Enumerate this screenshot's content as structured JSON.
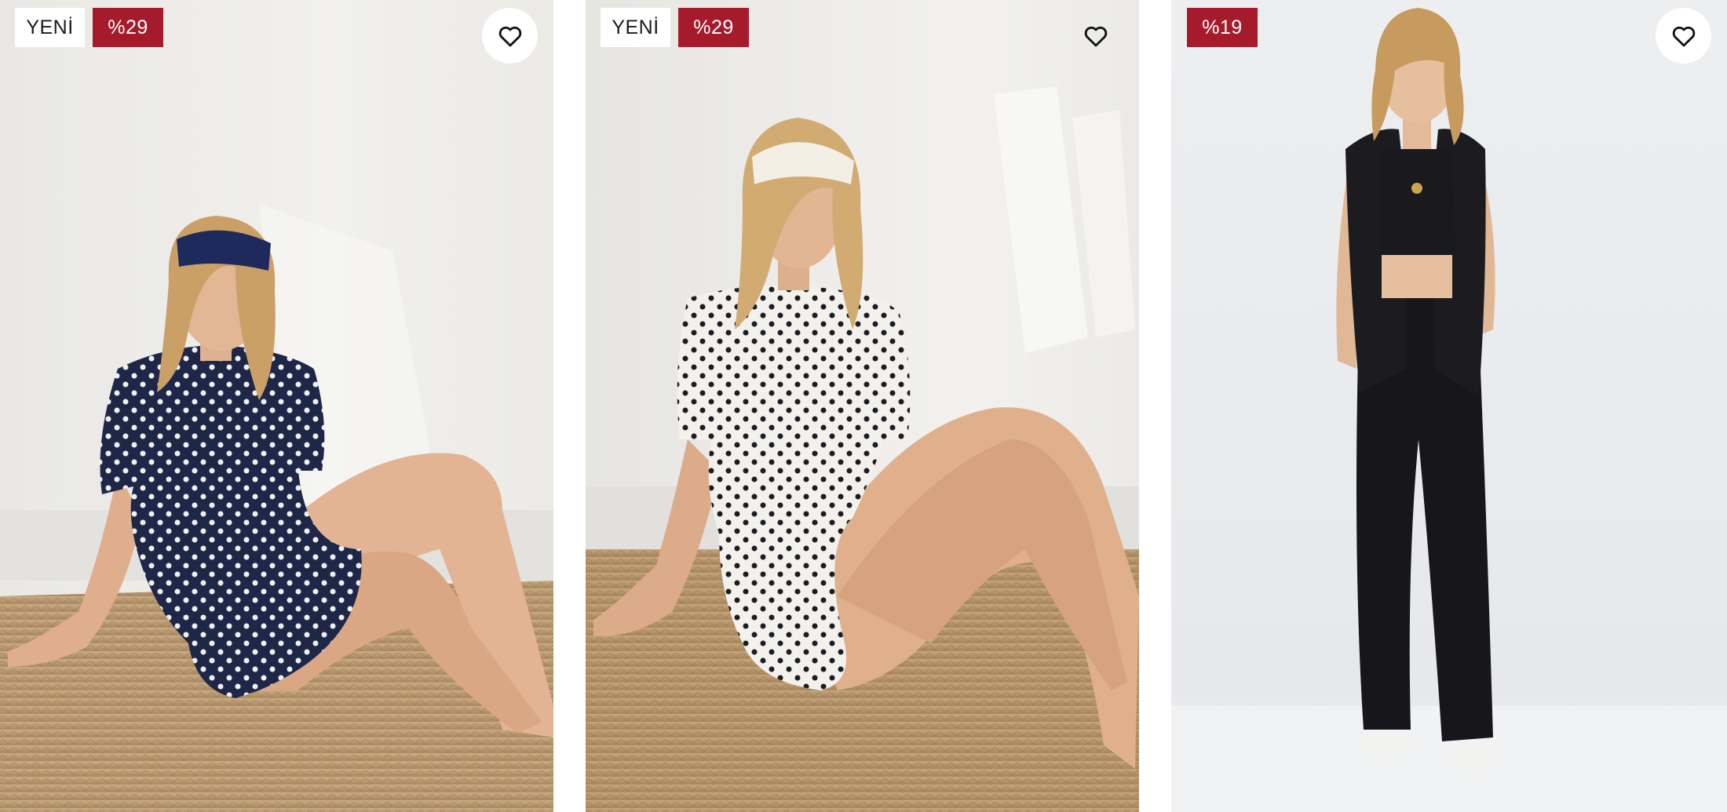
{
  "products": [
    {
      "badges": {
        "new": "YENİ",
        "discount": "%29"
      },
      "favorite_icon": "heart-outline-icon",
      "image_alt": "navy polka dot pajama set"
    },
    {
      "badges": {
        "new": "YENİ",
        "discount": "%29"
      },
      "favorite_icon": "heart-outline-icon",
      "image_alt": "white polka dot pajama set"
    },
    {
      "badges": {
        "discount": "%19"
      },
      "favorite_icon": "heart-outline-icon",
      "image_alt": "black vest crop top and wide leg trousers"
    }
  ],
  "colors": {
    "discount_badge_bg": "#a61b2b",
    "new_badge_bg": "#ffffff",
    "icon": "#111111"
  }
}
